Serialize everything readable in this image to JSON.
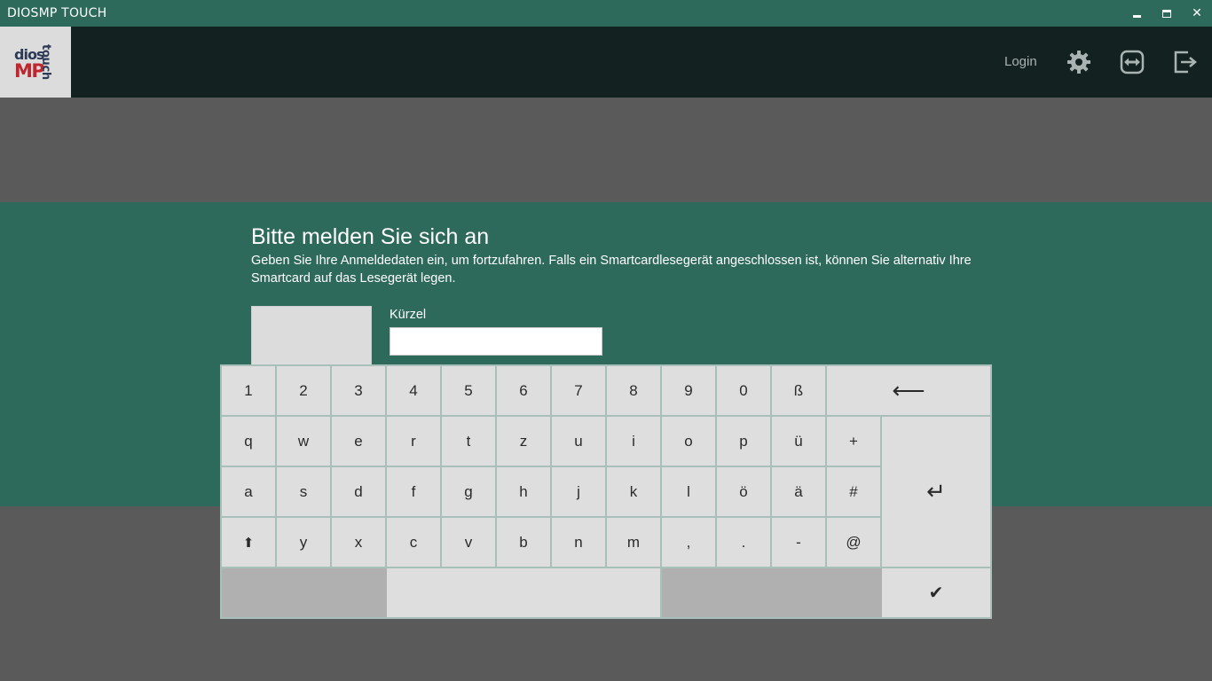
{
  "window": {
    "title": "DIOSMP TOUCH",
    "minimize": "minimize-icon",
    "maximize": "maximize-icon",
    "close": "close-icon"
  },
  "header": {
    "logo": {
      "dios": "dios",
      "mp": "MP",
      "touch": "touch"
    },
    "login_label": "Login",
    "icons": [
      "gear-icon",
      "teamviewer-icon",
      "exit-icon"
    ]
  },
  "login": {
    "heading": "Bitte melden Sie sich an",
    "description": "Geben Sie Ihre Anmeldedaten ein, um fortzufahren. Falls ein Smartcardlesegerät angeschlossen ist, können Sie alternativ Ihre Smartcard auf das Lesegerät legen.",
    "field_label": "Kürzel",
    "field_value": ""
  },
  "keyboard": {
    "row1": [
      "1",
      "2",
      "3",
      "4",
      "5",
      "6",
      "7",
      "8",
      "9",
      "0",
      "ß"
    ],
    "row2": [
      "q",
      "w",
      "e",
      "r",
      "t",
      "z",
      "u",
      "i",
      "o",
      "p",
      "ü",
      "+"
    ],
    "row3": [
      "a",
      "s",
      "d",
      "f",
      "g",
      "h",
      "j",
      "k",
      "l",
      "ö",
      "ä",
      "#"
    ],
    "row4": [
      "y",
      "x",
      "c",
      "v",
      "b",
      "n",
      "m",
      ",",
      ".",
      "-",
      "@"
    ],
    "backspace": "⟵",
    "enter": "↵",
    "shift": "⬆",
    "confirm": "✔"
  },
  "colors": {
    "titlebar": "#2e6a5c",
    "header": "#132220",
    "panel": "#2e6a5c",
    "background": "#5a5a5a",
    "key": "#dedede",
    "key_dark": "#b0b0b0"
  }
}
